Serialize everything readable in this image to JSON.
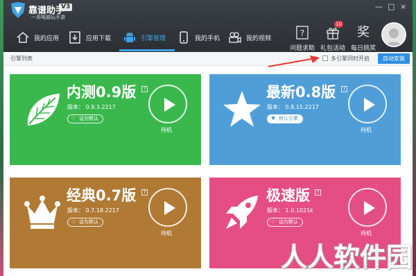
{
  "app": {
    "name": "靠谱助手",
    "slogan": "一用电脑玩手游",
    "version_badge": "V3",
    "window_controls": [
      "—",
      "□",
      "×"
    ]
  },
  "nav": {
    "tabs": [
      {
        "label": "我的应用",
        "icon": "home-icon"
      },
      {
        "label": "应用下载",
        "icon": "download-icon"
      },
      {
        "label": "引擎管理",
        "icon": "android-icon",
        "active": true
      },
      {
        "label": "我的手机",
        "icon": "phone-icon"
      },
      {
        "label": "我的视频",
        "icon": "video-camera-icon"
      }
    ],
    "right": [
      {
        "label": "问题求助",
        "icon": "help-icon"
      },
      {
        "label": "礼包活动",
        "icon": "gift-icon",
        "badge": "10"
      },
      {
        "label": "每日挑奖",
        "icon": "award-icon",
        "glyph": "奖"
      }
    ]
  },
  "subbar": {
    "title": "引擎列表",
    "multi_open_label": "多引擎同时开启",
    "auto_install_label": "自动安装"
  },
  "engines": [
    {
      "title": "内测0.9版",
      "version": "版本：  0.9.3.2217",
      "default_label": "设为默认",
      "status": "待机",
      "color": "#3ab84d",
      "icon": "leaf-icon"
    },
    {
      "title": "最新0.8版",
      "version": "版本：  0.8.15.2217",
      "default_label": "默认引擎",
      "default_active": true,
      "status": "待机",
      "color": "#4f9ed8",
      "icon": "star-icon"
    },
    {
      "title": "经典0.7版",
      "version": "版本：  0.7.18.2217",
      "default_label": "设为默认",
      "status": "待机",
      "color": "#b07a35",
      "icon": "crown-icon"
    },
    {
      "title": "极速版",
      "version": "版本：  1.0.1021k",
      "default_label": "设为默认",
      "status": "待机",
      "color": "#e44e82",
      "icon": "rocket-icon"
    }
  ],
  "watermark": "人人软件园"
}
